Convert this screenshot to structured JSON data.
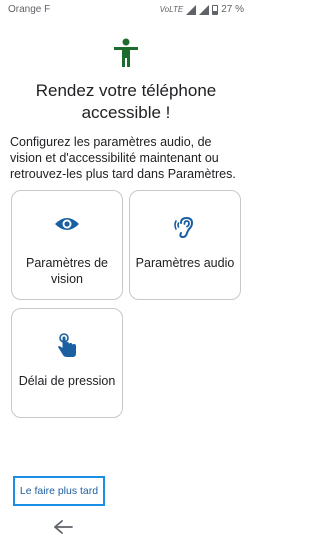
{
  "status_bar": {
    "carrier": "Orange F",
    "volte": "VoLTE",
    "battery": "27 %"
  },
  "header": {
    "title": "Rendez votre téléphone accessible !",
    "description": "Configurez les paramètres audio, de vision et d'accessibilité maintenant ou retrouvez-les plus tard dans Paramètres."
  },
  "tiles": [
    {
      "label": "Paramètres de vision",
      "icon": "eye-icon"
    },
    {
      "label": "Paramètres audio",
      "icon": "ear-icon"
    },
    {
      "label": "Délai de pression",
      "icon": "touch-icon"
    }
  ],
  "later_button": "Le faire plus tard",
  "colors": {
    "accent": "#1a5fa0",
    "hero": "#1e6b2e",
    "focus": "#1a8fe3"
  }
}
